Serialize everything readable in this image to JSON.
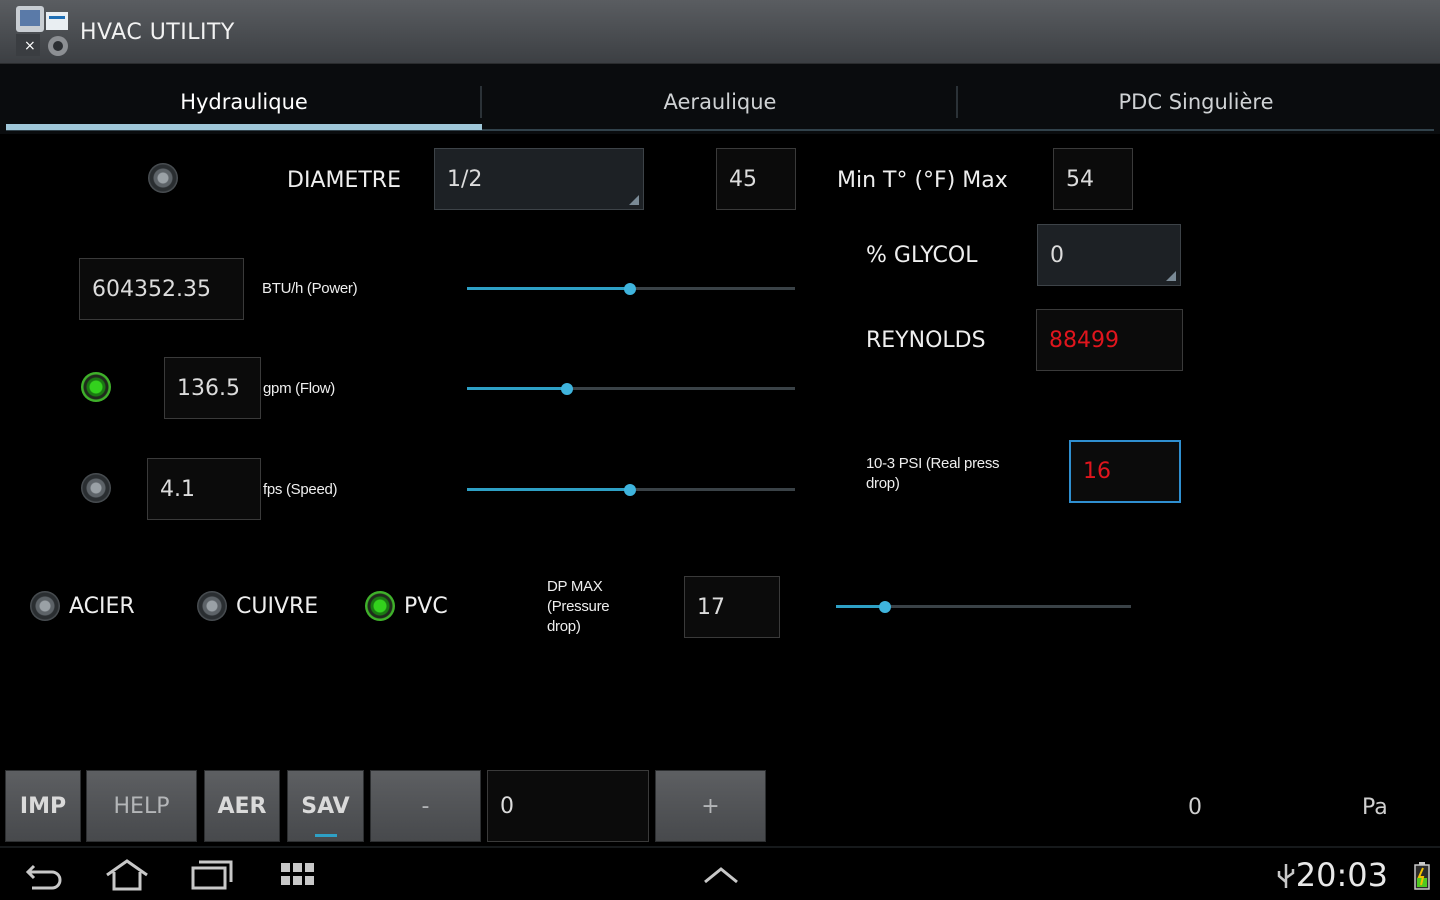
{
  "app": {
    "title": "HVAC UTILITY"
  },
  "tabs": [
    {
      "label": "Hydraulique",
      "active": true
    },
    {
      "label": "Aeraulique",
      "active": false
    },
    {
      "label": "PDC Singulière",
      "active": false
    }
  ],
  "diameter": {
    "label": "DIAMETRE",
    "value": "1/2",
    "selected": false
  },
  "temp": {
    "min_value": "45",
    "label": "Min  T° (°F)  Max",
    "max_value": "54"
  },
  "glycol": {
    "label": "% GLYCOL",
    "value": "0"
  },
  "reynolds": {
    "label": "REYNOLDS",
    "value": "88499",
    "color": "#e0151d"
  },
  "real_drop": {
    "label": "10-3 PSI (Real press drop)",
    "value": "16",
    "color": "#e0151d"
  },
  "power": {
    "value": "604352.35",
    "unit": "BTU/h (Power)",
    "slider_level": 0.5
  },
  "flow": {
    "value": "136.5",
    "unit": "gpm (Flow)",
    "selected": true,
    "slider_level": 0.3
  },
  "speed": {
    "value": "4.1",
    "unit": "fps (Speed)",
    "selected": false,
    "slider_level": 0.5
  },
  "materials": [
    {
      "label": "ACIER",
      "selected": false
    },
    {
      "label": "CUIVRE",
      "selected": false
    },
    {
      "label": "PVC",
      "selected": true
    }
  ],
  "dp_max": {
    "label": "DP MAX (Pressure drop)",
    "value": "17",
    "slider_level": 0.16
  },
  "toolbar": {
    "imp_label": "IMP",
    "help_label": "HELP",
    "aer_label": "AER",
    "sav_label": "SAV",
    "minus_label": "-",
    "counter_value": "0",
    "plus_label": "+",
    "readout_value": "0",
    "readout_unit": "Pa"
  },
  "status": {
    "time": "20:03"
  },
  "colors": {
    "accent": "#2ea0c5",
    "selected_radio": "#33d11d",
    "error_text": "#e0151d"
  }
}
